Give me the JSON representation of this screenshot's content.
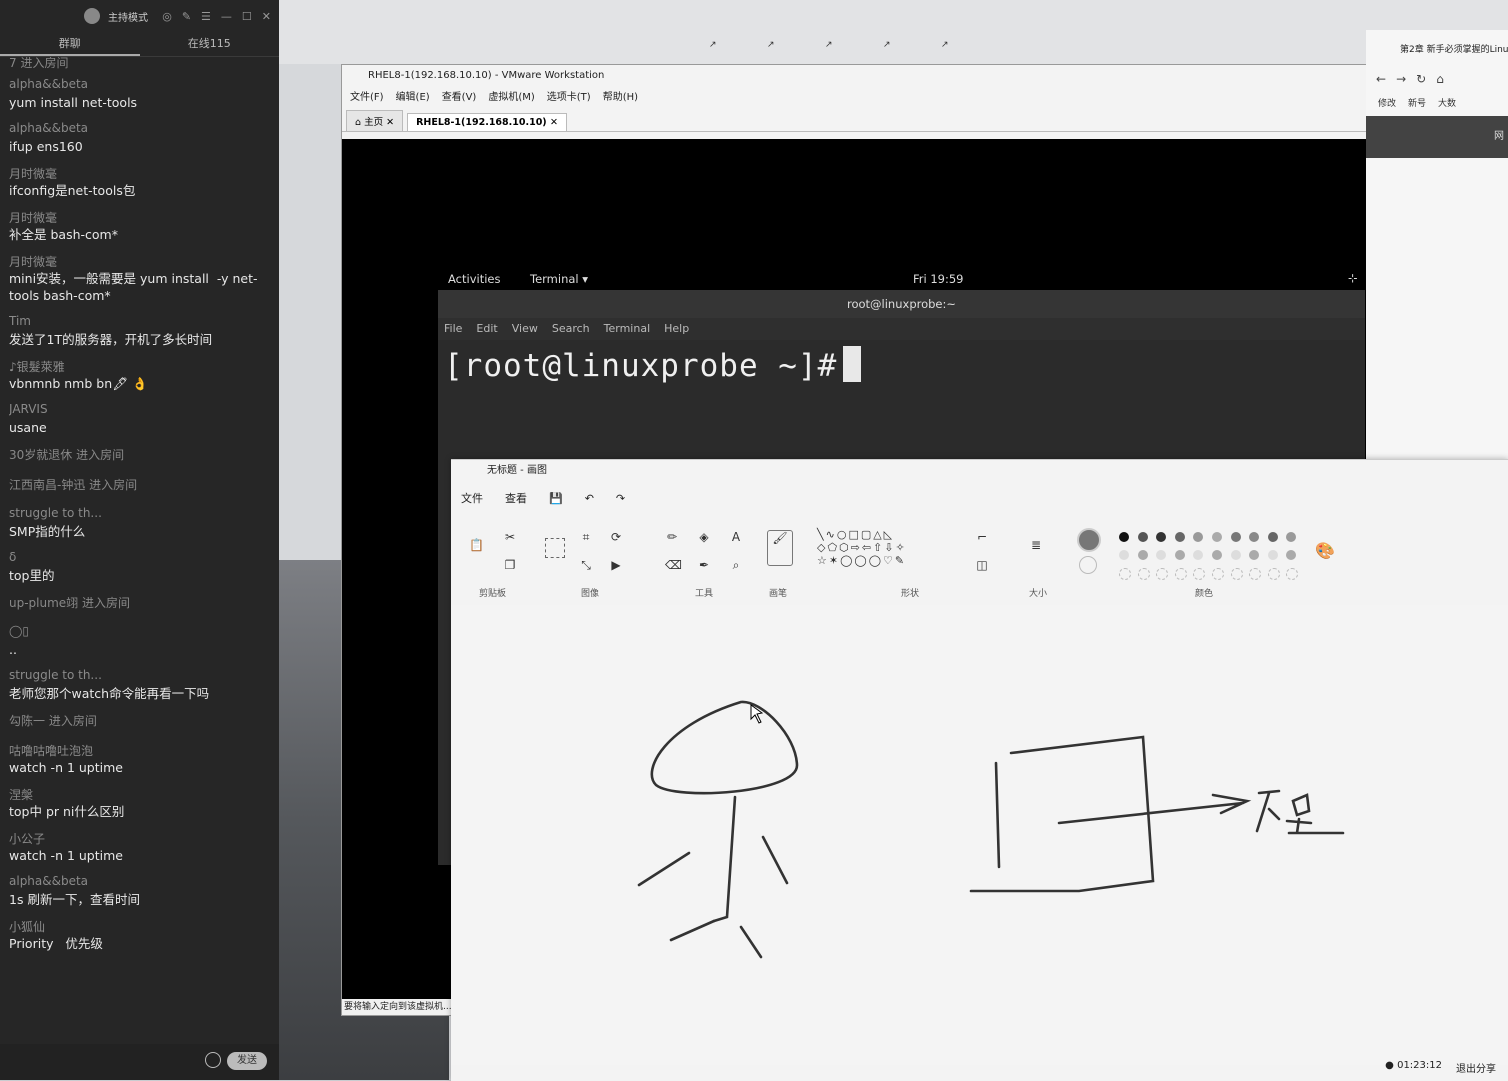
{
  "chat": {
    "mode_title": "主持模式",
    "tabs": [
      "群聊",
      "在线115"
    ],
    "first_system": "7 进入房间",
    "messages": [
      {
        "user": "alpha&&beta",
        "text": "yum install net-tools"
      },
      {
        "user": "alpha&&beta",
        "text": "ifup ens160"
      },
      {
        "user": "月时微毫",
        "text": "ifconfig是net-tools包"
      },
      {
        "user": "月时微毫",
        "text": "补全是 bash-com*"
      },
      {
        "user": "月时微毫",
        "text": "mini安装，一般需要是 yum install  -y net-tools bash-com*"
      },
      {
        "user": "Tim",
        "text": "发送了1T的服务器，开机了多长时间"
      },
      {
        "user": "♪银髮萊雅",
        "text": "vbnmnb nmb bn🖋 👌"
      },
      {
        "user": "JARVIS",
        "text": "usane"
      },
      {
        "system": "30岁就退休 进入房间"
      },
      {
        "system": "江西南昌-钟迅 进入房间"
      },
      {
        "user": "struggle to th...",
        "text": "SMP指的什么"
      },
      {
        "user": "δ",
        "text": "top里的"
      },
      {
        "system": "up-plume翊 进入房间"
      },
      {
        "user": "◯▯",
        "text": ".."
      },
      {
        "user": "struggle to th...",
        "text": "老师您那个watch命令能再看一下吗"
      },
      {
        "system": "勾陈一 进入房间"
      },
      {
        "user": "咕噜咕噜吐泡泡",
        "text": "watch -n 1 uptime"
      },
      {
        "user": "涅槃",
        "text": "top中 pr ni什么区别"
      },
      {
        "user": "小公子",
        "text": "watch -n 1 uptime"
      },
      {
        "user": "alpha&&beta",
        "text": "1s 刷新一下，查看时间"
      },
      {
        "user": "小狐仙",
        "text": "Priority   优先级"
      }
    ],
    "send_label": "发送"
  },
  "vmware": {
    "title": "RHEL8-1(192.168.10.10) - VMware Workstation",
    "menu": [
      "文件(F)",
      "编辑(E)",
      "查看(V)",
      "虚拟机(M)",
      "选项卡(T)",
      "帮助(H)"
    ],
    "tabs": [
      "主页",
      "RHEL8-1(192.168.10.10)"
    ],
    "status": "要将输入定向到该虚拟机..."
  },
  "gnome": {
    "activities": "Activities",
    "app": "Terminal ▾",
    "clock": "Fri 19:59"
  },
  "terminal": {
    "title": "root@linuxprobe:~",
    "menu": [
      "File",
      "Edit",
      "View",
      "Search",
      "Terminal",
      "Help"
    ],
    "prompt": "[root@linuxprobe ~]#"
  },
  "browser": {
    "tab_title": "第2章 新手必须掌握的Linu",
    "bookmarks": [
      "修改",
      "新号",
      "大数"
    ],
    "banner": "网"
  },
  "paint": {
    "title": "无标题 - 画图",
    "menu": [
      "文件",
      "查看"
    ],
    "groups": [
      "剪贴板",
      "图像",
      "工具",
      "画笔",
      "形状",
      "大小",
      "颜色"
    ],
    "status_time": "01:23:12",
    "status_exit": "退出分享"
  },
  "colors": {
    "chat_bg": "#262626",
    "terminal_bg": "#2b2b2b",
    "paint_bg": "#f4f4f4"
  }
}
